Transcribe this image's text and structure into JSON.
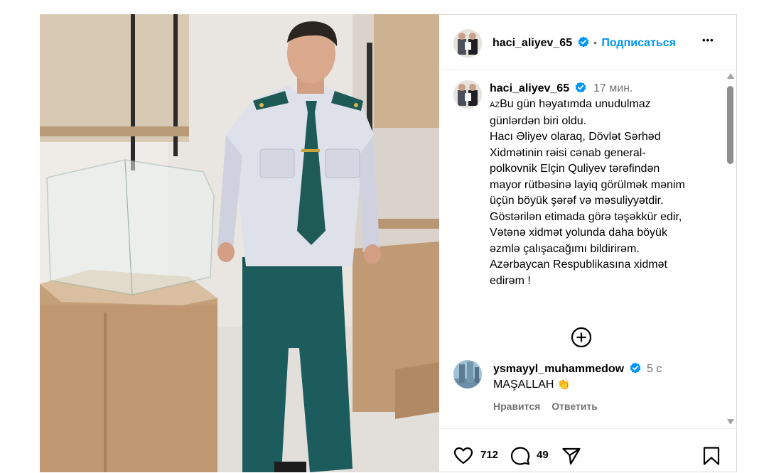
{
  "post": {
    "author": "haci_aliyev_65",
    "separator": "•",
    "follow_label": "Подписаться",
    "more_label": "•••",
    "caption": {
      "username": "haci_aliyev_65",
      "time": "17 мин.",
      "lang_tag": "AZ",
      "lines": [
        "Bu gün həyatımda unudulmaz",
        "günlərdən biri oldu.",
        "Hacı Əliyev olaraq, Dövlət Sərhəd",
        "Xidmətinin rəisi cənab general-",
        "polkovnik Elçin Quliyev tərəfindən",
        "mayor rütbəsinə layiq görülmək mənim",
        "üçün böyük şərəf və məsuliyyətdir.",
        "Göstərilən etimada görə təşəkkür edir,",
        "Vətənə xidmət yolunda daha böyük",
        "əzmlə çalışacağımı bildirirəm.",
        "Azərbaycan Respublikasına xidmət",
        "edirəm !"
      ]
    },
    "comment": {
      "username": "ysmayyl_muhammedow",
      "time": "5 с",
      "text": "MAŞALLAH",
      "emoji": "👏",
      "like_label": "Нравится",
      "reply_label": "Ответить"
    },
    "stats": {
      "likes": "712",
      "comments": "49"
    }
  },
  "icons": {
    "verified": "verified-badge-icon",
    "load_more": "plus-circle-icon",
    "like": "heart-icon",
    "comment": "comment-bubble-icon",
    "share": "paper-plane-icon",
    "save": "bookmark-icon"
  },
  "colors": {
    "link_blue": "#0095f6",
    "verified_blue": "#0095f6",
    "muted_gray": "#737373",
    "border": "#dbdbdb"
  }
}
